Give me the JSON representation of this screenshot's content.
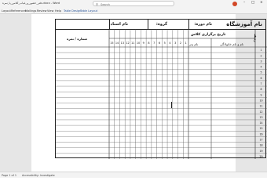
{
  "titlebar": {
    "document_name": "دفتر_حضور_و_غیاب_کلاس_با_نمره.docx - Word",
    "search_placeholder": "Search",
    "window_controls": [
      "minimize-icon",
      "restore-icon",
      "close-icon"
    ]
  },
  "ribbon": {
    "tabs": [
      "Layout",
      "References",
      "Mailings",
      "Review",
      "View",
      "Help",
      "Table Design",
      "Table Layout"
    ],
    "accent_color": "#2b579a"
  },
  "form": {
    "title": "نام آموزشگاه",
    "course_label": "نام دوره:",
    "group_label": "گروه:",
    "teacher_label": "نام استاد:",
    "date_label": "تاریخ برگزاری کلاس",
    "father_label": "نام پدر",
    "name_label": "نام و نام خانوادگی",
    "score_label": "شماره / نمره",
    "row_label": "ردیف",
    "session_numbers": [
      "1",
      "2",
      "3",
      "4",
      "5",
      "6",
      "7",
      "8",
      "9",
      "10",
      "11",
      "12",
      "13",
      "14",
      "15"
    ],
    "row_numbers": [
      "1",
      "2",
      "3",
      "4",
      "5",
      "6",
      "7",
      "8",
      "9",
      "10",
      "11",
      "12",
      "13",
      "14",
      "15",
      "16",
      "17",
      "18",
      "19",
      "20"
    ]
  },
  "statusbar": {
    "page_info": "Page 1 of 1",
    "accessibility": "Accessibility: Investigate"
  }
}
